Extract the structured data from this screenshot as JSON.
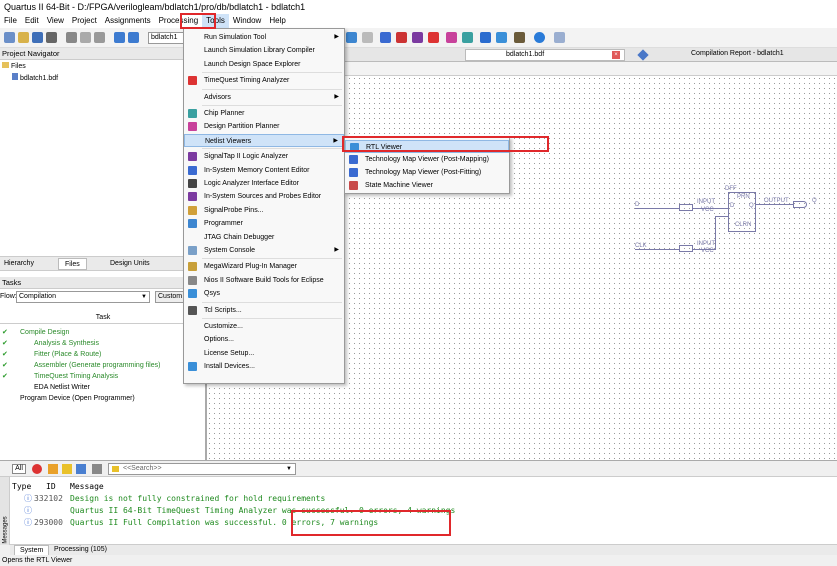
{
  "title": "Quartus II 64-Bit - D:/FPGA/verilogleam/bdlatch1/pro/db/bdlatch1 - bdlatch1",
  "menus": [
    "File",
    "Edit",
    "View",
    "Project",
    "Assignments",
    "Processing",
    "Tools",
    "Window",
    "Help"
  ],
  "toolbar": {
    "project_combo": "bdlatch1"
  },
  "tabs": {
    "bdf": "bdlatch1.bdf",
    "report": "Compilation Report - bdlatch1"
  },
  "navigator": {
    "title": "Project Navigator",
    "files_label": "Files",
    "file": "bdlatch1.bdf",
    "tabs": [
      "Hierarchy",
      "Files",
      "Design Units"
    ]
  },
  "tasks": {
    "title": "Tasks",
    "flow_label": "Flow:",
    "flow_value": "Compilation",
    "custom": "Custom",
    "column": "Task",
    "items": [
      "Compile Design",
      "Analysis & Synthesis",
      "Fitter (Place & Route)",
      "Assembler (Generate programming files)",
      "TimeQuest Timing Analysis",
      "EDA Netlist Writer",
      "Program Device (Open Programmer)"
    ]
  },
  "tools_menu": [
    "Run Simulation Tool",
    "Launch Simulation Library Compiler",
    "Launch Design Space Explorer",
    "TimeQuest Timing Analyzer",
    "Advisors",
    "Chip Planner",
    "Design Partition Planner",
    "Netlist Viewers",
    "SignalTap II Logic Analyzer",
    "In-System Memory Content Editor",
    "Logic Analyzer Interface Editor",
    "In-System Sources and Probes Editor",
    "SignalProbe Pins...",
    "Programmer",
    "JTAG Chain Debugger",
    "System Console",
    "MegaWizard Plug-In Manager",
    "Nios II Software Build Tools for Eclipse",
    "Qsys",
    "Tcl Scripts...",
    "Customize...",
    "Options...",
    "License Setup...",
    "Install Devices..."
  ],
  "netlist_menu": [
    "RTL Viewer",
    "Technology Map Viewer (Post-Mapping)",
    "Technology Map Viewer (Post-Fitting)",
    "State Machine Viewer"
  ],
  "schematic": {
    "d": "D",
    "clk": "CLK",
    "q": "Q",
    "input": "INPUT",
    "vcc": "VCC",
    "output": "OUTPUT",
    "dff": "DFF",
    "prn": "PRN",
    "clrn": "CLRN",
    "dpin": "D",
    "qpin": "Q"
  },
  "messages": {
    "filter_all": "All",
    "search_placeholder": "<<Search>>",
    "col_type": "Type",
    "col_id": "ID",
    "col_msg": "Message",
    "rows": [
      {
        "id": "332102",
        "text": "Design is not fully constrained for hold requirements"
      },
      {
        "id": "",
        "text": "Quartus II 64-Bit TimeQuest Timing Analyzer was successful. 0 errors, 4 warnings"
      },
      {
        "id": "293000",
        "text": "Quartus II Full Compilation was successful. 0 errors, 7 warnings"
      }
    ],
    "tabs": [
      "System",
      "Processing (105)"
    ],
    "side": "Messages"
  },
  "status": "Opens the RTL Viewer"
}
